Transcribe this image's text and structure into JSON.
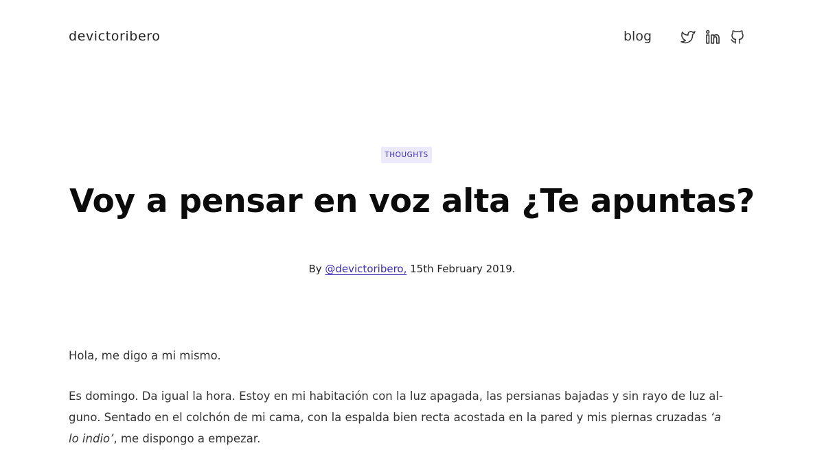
{
  "header": {
    "site_name": "devictoribero",
    "nav_blog": "blog",
    "social": [
      "twitter-icon",
      "linkedin-icon",
      "github-icon"
    ]
  },
  "post": {
    "category": "THOUGHTS",
    "title": "Voy a pensar en voz alta ¿Te apuntas?",
    "byline_prefix": "By",
    "author_handle": "@devictoribero,",
    "date": "15th February 2019."
  },
  "body": {
    "paragraph1": "Hola, me digo a mi mismo.",
    "paragraph2_line1": "Es domingo. Da igual la hora. Estoy en mi habitación con la luz apagada, las persianas bajadas y sin rayo de luz al-",
    "paragraph2_line2": "guno. Sentado en el colchón de mi cama, con la espalda bien recta acostada en la pared y mis piernas cruzadas",
    "paragraph2_italic_a": "‘a",
    "paragraph2_italic_b": "lo indio’",
    "paragraph2_line3_rest": ", me dispongo a empezar."
  },
  "colors": {
    "accent": "#3a2ab8",
    "tag_bg": "#ece9fb",
    "text": "#333333",
    "title": "#0b0b0b"
  }
}
